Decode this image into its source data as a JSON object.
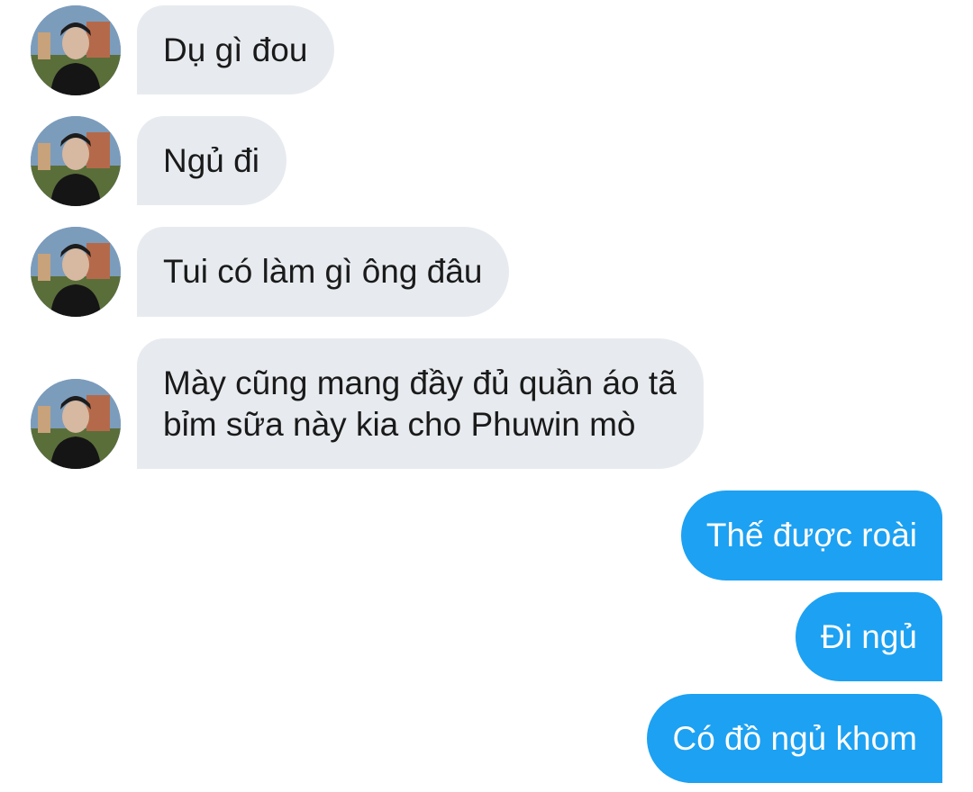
{
  "colors": {
    "incoming_bubble": "#e7ebef",
    "outgoing_bubble": "#1da1f2",
    "incoming_text": "#1a1a1a",
    "outgoing_text": "#ffffff"
  },
  "icons": {
    "avatar": "profile-photo-avatar"
  },
  "messages": [
    {
      "direction": "incoming",
      "lines": [
        "Dụ gì đou"
      ]
    },
    {
      "direction": "incoming",
      "lines": [
        "Ngủ đi"
      ]
    },
    {
      "direction": "incoming",
      "lines": [
        "Tui có làm gì ông đâu"
      ]
    },
    {
      "direction": "incoming",
      "lines": [
        "Mày cũng mang đầy đủ quần áo tã",
        "bỉm sữa này kia cho Phuwin mò"
      ]
    },
    {
      "direction": "outgoing",
      "lines": [
        "Thế được roài"
      ]
    },
    {
      "direction": "outgoing",
      "lines": [
        "Đi ngủ"
      ]
    },
    {
      "direction": "outgoing",
      "lines": [
        "Có đồ ngủ khom"
      ]
    }
  ]
}
